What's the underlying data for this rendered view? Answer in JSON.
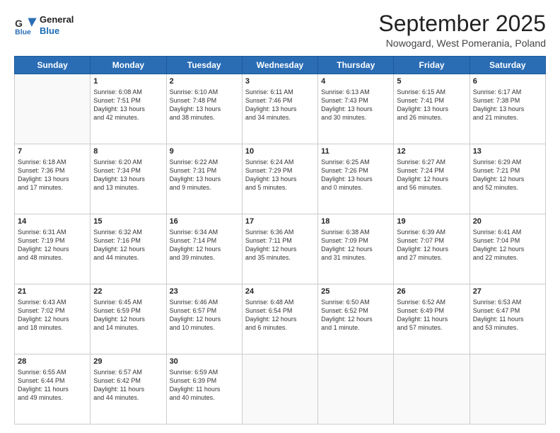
{
  "header": {
    "logo_line1": "General",
    "logo_line2": "Blue",
    "month": "September 2025",
    "location": "Nowogard, West Pomerania, Poland"
  },
  "weekdays": [
    "Sunday",
    "Monday",
    "Tuesday",
    "Wednesday",
    "Thursday",
    "Friday",
    "Saturday"
  ],
  "weeks": [
    [
      {
        "day": "",
        "info": ""
      },
      {
        "day": "1",
        "info": "Sunrise: 6:08 AM\nSunset: 7:51 PM\nDaylight: 13 hours\nand 42 minutes."
      },
      {
        "day": "2",
        "info": "Sunrise: 6:10 AM\nSunset: 7:48 PM\nDaylight: 13 hours\nand 38 minutes."
      },
      {
        "day": "3",
        "info": "Sunrise: 6:11 AM\nSunset: 7:46 PM\nDaylight: 13 hours\nand 34 minutes."
      },
      {
        "day": "4",
        "info": "Sunrise: 6:13 AM\nSunset: 7:43 PM\nDaylight: 13 hours\nand 30 minutes."
      },
      {
        "day": "5",
        "info": "Sunrise: 6:15 AM\nSunset: 7:41 PM\nDaylight: 13 hours\nand 26 minutes."
      },
      {
        "day": "6",
        "info": "Sunrise: 6:17 AM\nSunset: 7:38 PM\nDaylight: 13 hours\nand 21 minutes."
      }
    ],
    [
      {
        "day": "7",
        "info": "Sunrise: 6:18 AM\nSunset: 7:36 PM\nDaylight: 13 hours\nand 17 minutes."
      },
      {
        "day": "8",
        "info": "Sunrise: 6:20 AM\nSunset: 7:34 PM\nDaylight: 13 hours\nand 13 minutes."
      },
      {
        "day": "9",
        "info": "Sunrise: 6:22 AM\nSunset: 7:31 PM\nDaylight: 13 hours\nand 9 minutes."
      },
      {
        "day": "10",
        "info": "Sunrise: 6:24 AM\nSunset: 7:29 PM\nDaylight: 13 hours\nand 5 minutes."
      },
      {
        "day": "11",
        "info": "Sunrise: 6:25 AM\nSunset: 7:26 PM\nDaylight: 13 hours\nand 0 minutes."
      },
      {
        "day": "12",
        "info": "Sunrise: 6:27 AM\nSunset: 7:24 PM\nDaylight: 12 hours\nand 56 minutes."
      },
      {
        "day": "13",
        "info": "Sunrise: 6:29 AM\nSunset: 7:21 PM\nDaylight: 12 hours\nand 52 minutes."
      }
    ],
    [
      {
        "day": "14",
        "info": "Sunrise: 6:31 AM\nSunset: 7:19 PM\nDaylight: 12 hours\nand 48 minutes."
      },
      {
        "day": "15",
        "info": "Sunrise: 6:32 AM\nSunset: 7:16 PM\nDaylight: 12 hours\nand 44 minutes."
      },
      {
        "day": "16",
        "info": "Sunrise: 6:34 AM\nSunset: 7:14 PM\nDaylight: 12 hours\nand 39 minutes."
      },
      {
        "day": "17",
        "info": "Sunrise: 6:36 AM\nSunset: 7:11 PM\nDaylight: 12 hours\nand 35 minutes."
      },
      {
        "day": "18",
        "info": "Sunrise: 6:38 AM\nSunset: 7:09 PM\nDaylight: 12 hours\nand 31 minutes."
      },
      {
        "day": "19",
        "info": "Sunrise: 6:39 AM\nSunset: 7:07 PM\nDaylight: 12 hours\nand 27 minutes."
      },
      {
        "day": "20",
        "info": "Sunrise: 6:41 AM\nSunset: 7:04 PM\nDaylight: 12 hours\nand 22 minutes."
      }
    ],
    [
      {
        "day": "21",
        "info": "Sunrise: 6:43 AM\nSunset: 7:02 PM\nDaylight: 12 hours\nand 18 minutes."
      },
      {
        "day": "22",
        "info": "Sunrise: 6:45 AM\nSunset: 6:59 PM\nDaylight: 12 hours\nand 14 minutes."
      },
      {
        "day": "23",
        "info": "Sunrise: 6:46 AM\nSunset: 6:57 PM\nDaylight: 12 hours\nand 10 minutes."
      },
      {
        "day": "24",
        "info": "Sunrise: 6:48 AM\nSunset: 6:54 PM\nDaylight: 12 hours\nand 6 minutes."
      },
      {
        "day": "25",
        "info": "Sunrise: 6:50 AM\nSunset: 6:52 PM\nDaylight: 12 hours\nand 1 minute."
      },
      {
        "day": "26",
        "info": "Sunrise: 6:52 AM\nSunset: 6:49 PM\nDaylight: 11 hours\nand 57 minutes."
      },
      {
        "day": "27",
        "info": "Sunrise: 6:53 AM\nSunset: 6:47 PM\nDaylight: 11 hours\nand 53 minutes."
      }
    ],
    [
      {
        "day": "28",
        "info": "Sunrise: 6:55 AM\nSunset: 6:44 PM\nDaylight: 11 hours\nand 49 minutes."
      },
      {
        "day": "29",
        "info": "Sunrise: 6:57 AM\nSunset: 6:42 PM\nDaylight: 11 hours\nand 44 minutes."
      },
      {
        "day": "30",
        "info": "Sunrise: 6:59 AM\nSunset: 6:39 PM\nDaylight: 11 hours\nand 40 minutes."
      },
      {
        "day": "",
        "info": ""
      },
      {
        "day": "",
        "info": ""
      },
      {
        "day": "",
        "info": ""
      },
      {
        "day": "",
        "info": ""
      }
    ]
  ]
}
